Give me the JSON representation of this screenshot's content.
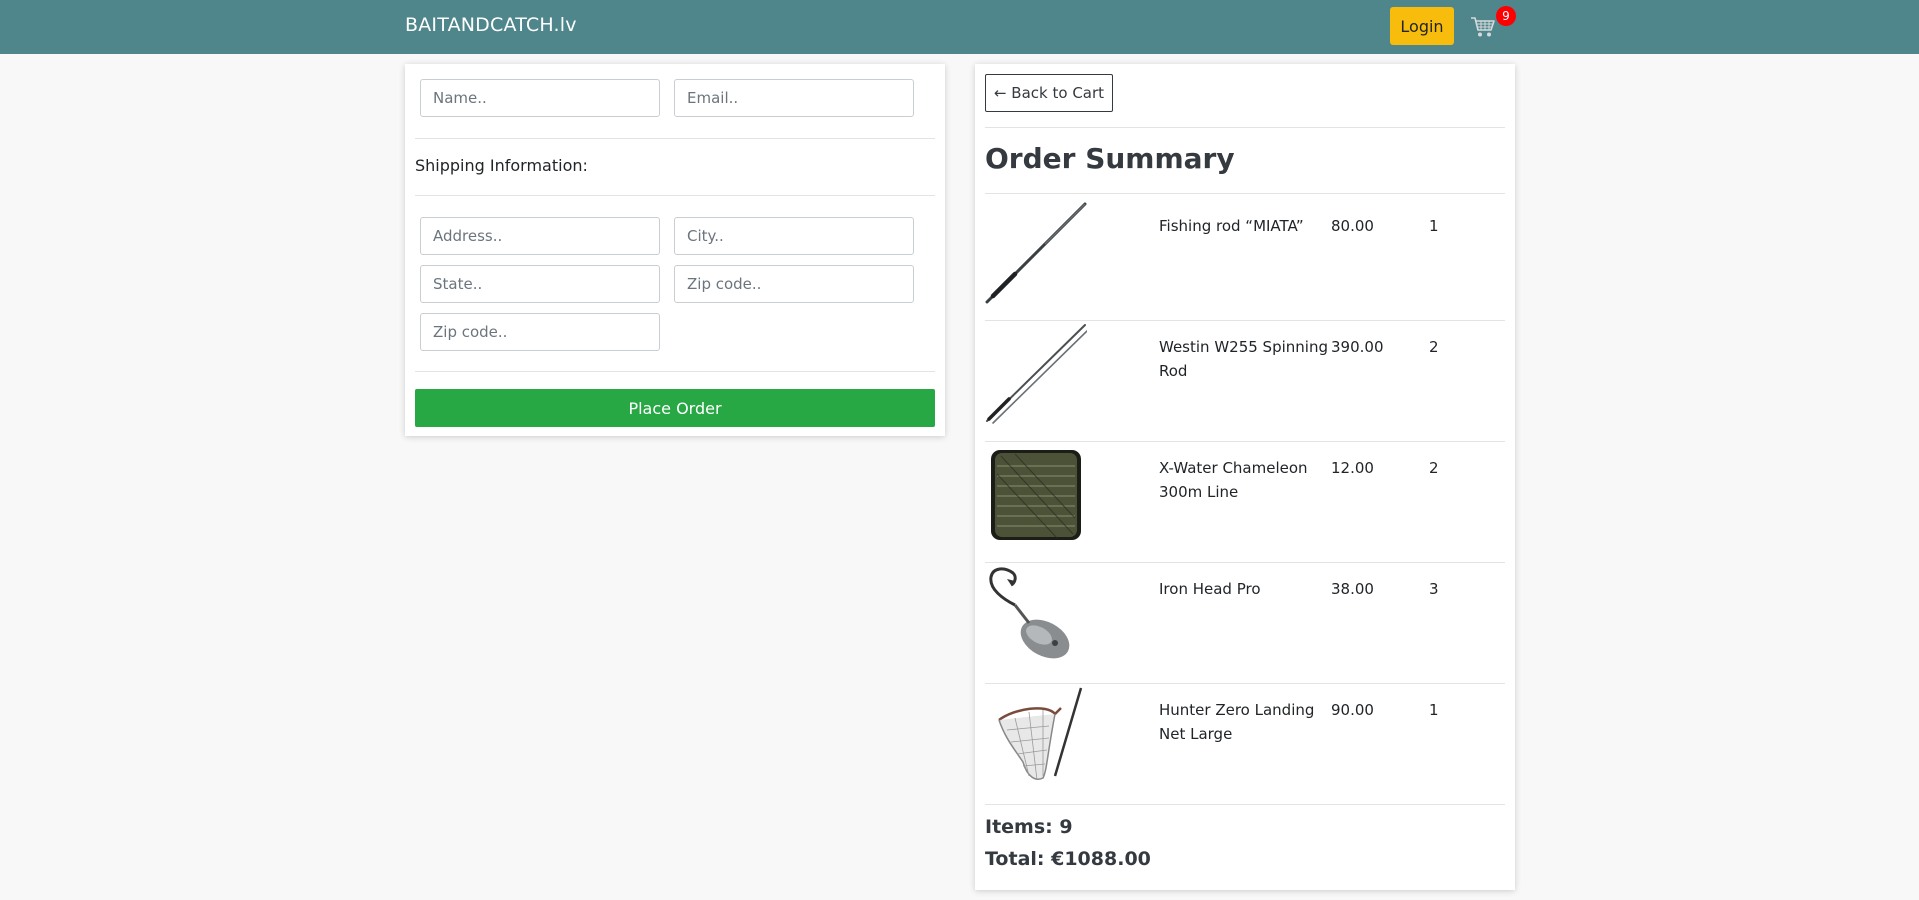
{
  "navbar": {
    "brand": "BAITANDCATCH.lv",
    "login_label": "Login",
    "cart_count": "9",
    "colors": {
      "bar": "#4f868b",
      "login": "#f8bd0c",
      "badge": "#ff0000"
    }
  },
  "form": {
    "name_placeholder": "Name..",
    "email_placeholder": "Email..",
    "shipping_label": "Shipping Information:",
    "address_placeholder": "Address..",
    "city_placeholder": "City..",
    "state_placeholder": "State..",
    "zip_placeholder": "Zip code..",
    "zip2_placeholder": "Zip code..",
    "place_order_label": "Place Order",
    "place_order_color": "#28a745"
  },
  "summary": {
    "back_label": "← Back to Cart",
    "title": "Order Summary",
    "items": [
      {
        "name": "Fishing rod “MIATA”",
        "price": "80.00",
        "qty": "1",
        "icon": "fishing-rod"
      },
      {
        "name": "Westin W255 Spinning Rod",
        "price": "390.00",
        "qty": "2",
        "icon": "spinning-rod"
      },
      {
        "name": "X-Water Chameleon 300m Line",
        "price": "12.00",
        "qty": "2",
        "icon": "line-spool"
      },
      {
        "name": "Iron Head Pro",
        "price": "38.00",
        "qty": "3",
        "icon": "jig-head"
      },
      {
        "name": "Hunter Zero Landing Net Large",
        "price": "90.00",
        "qty": "1",
        "icon": "landing-net"
      }
    ],
    "items_label": "Items: 9",
    "total_label": "Total: €1088.00"
  }
}
